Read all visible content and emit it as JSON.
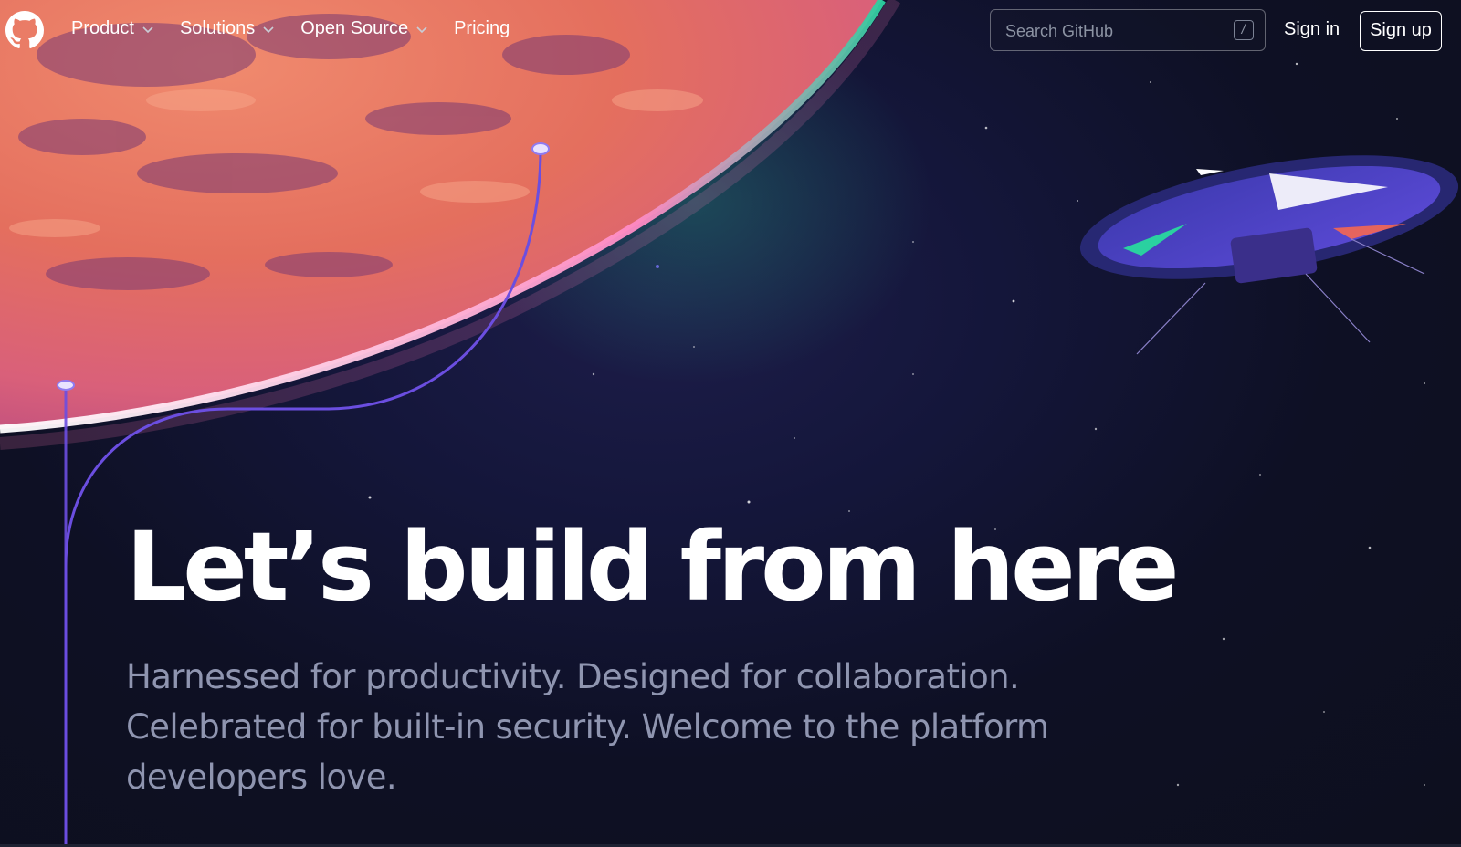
{
  "header": {
    "logo_name": "github-mark-icon",
    "nav": [
      {
        "label": "Product",
        "has_dropdown": true
      },
      {
        "label": "Solutions",
        "has_dropdown": true
      },
      {
        "label": "Open Source",
        "has_dropdown": true
      },
      {
        "label": "Pricing",
        "has_dropdown": false
      }
    ],
    "search": {
      "placeholder": "Search GitHub",
      "shortcut": "/"
    },
    "sign_in": "Sign in",
    "sign_up": "Sign up"
  },
  "hero": {
    "title": "Let’s build from here",
    "subtitle": "Harnessed for productivity. Designed for collaboration. Celebrated for built-in security. Welcome to the platform developers love."
  },
  "colors": {
    "background": "#0d1022",
    "planet": "#e8735f",
    "accent_line": "#6e40c9",
    "subtitle_text": "#8f95b0"
  }
}
